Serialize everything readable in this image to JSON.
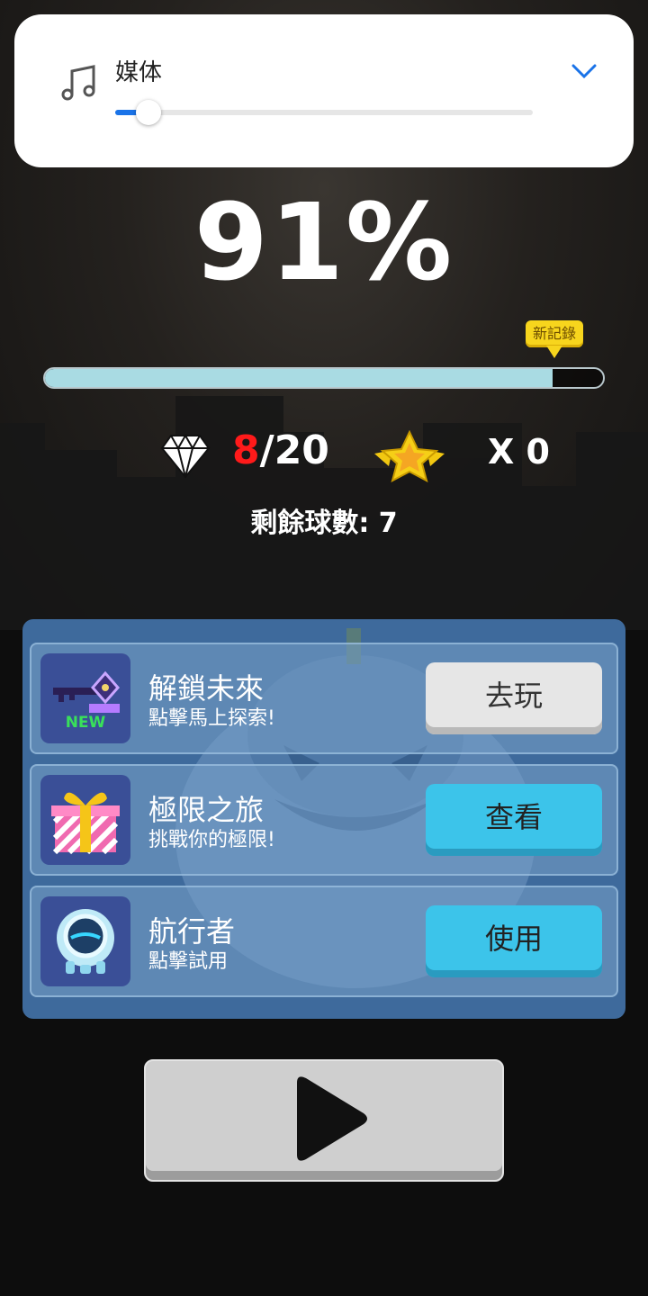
{
  "media_panel": {
    "label": "媒体",
    "volume_level": 0.08
  },
  "progress": {
    "percent_text": "91%",
    "value": 0.91,
    "record_badge": "新記錄"
  },
  "stats": {
    "gems_current": "8",
    "gems_total": "/20",
    "stars_text": "X 0",
    "balls_label": "剩餘球數: 7"
  },
  "offers": [
    {
      "title": "解鎖未來",
      "subtitle": "點擊馬上探索!",
      "button": "去玩",
      "button_style": "grey",
      "icon": "key-new-icon",
      "icon_badge": "NEW"
    },
    {
      "title": "極限之旅",
      "subtitle": "挑戰你的極限!",
      "button": "查看",
      "button_style": "cyan",
      "icon": "gift-icon"
    },
    {
      "title": "航行者",
      "subtitle": "點擊試用",
      "button": "使用",
      "button_style": "cyan",
      "icon": "robot-ball-icon"
    }
  ],
  "colors": {
    "accent_blue": "#1a73e8",
    "gem_red": "#ff1a1a",
    "button_cyan": "#3cc4ea",
    "panel_blue": "#3e6a9c",
    "progress_fill": "#a9dbe3",
    "badge_yellow": "#f7d51d"
  },
  "icons": [
    "music-note-icon",
    "chevron-down-icon",
    "diamond-icon",
    "star-icon",
    "play-icon"
  ]
}
